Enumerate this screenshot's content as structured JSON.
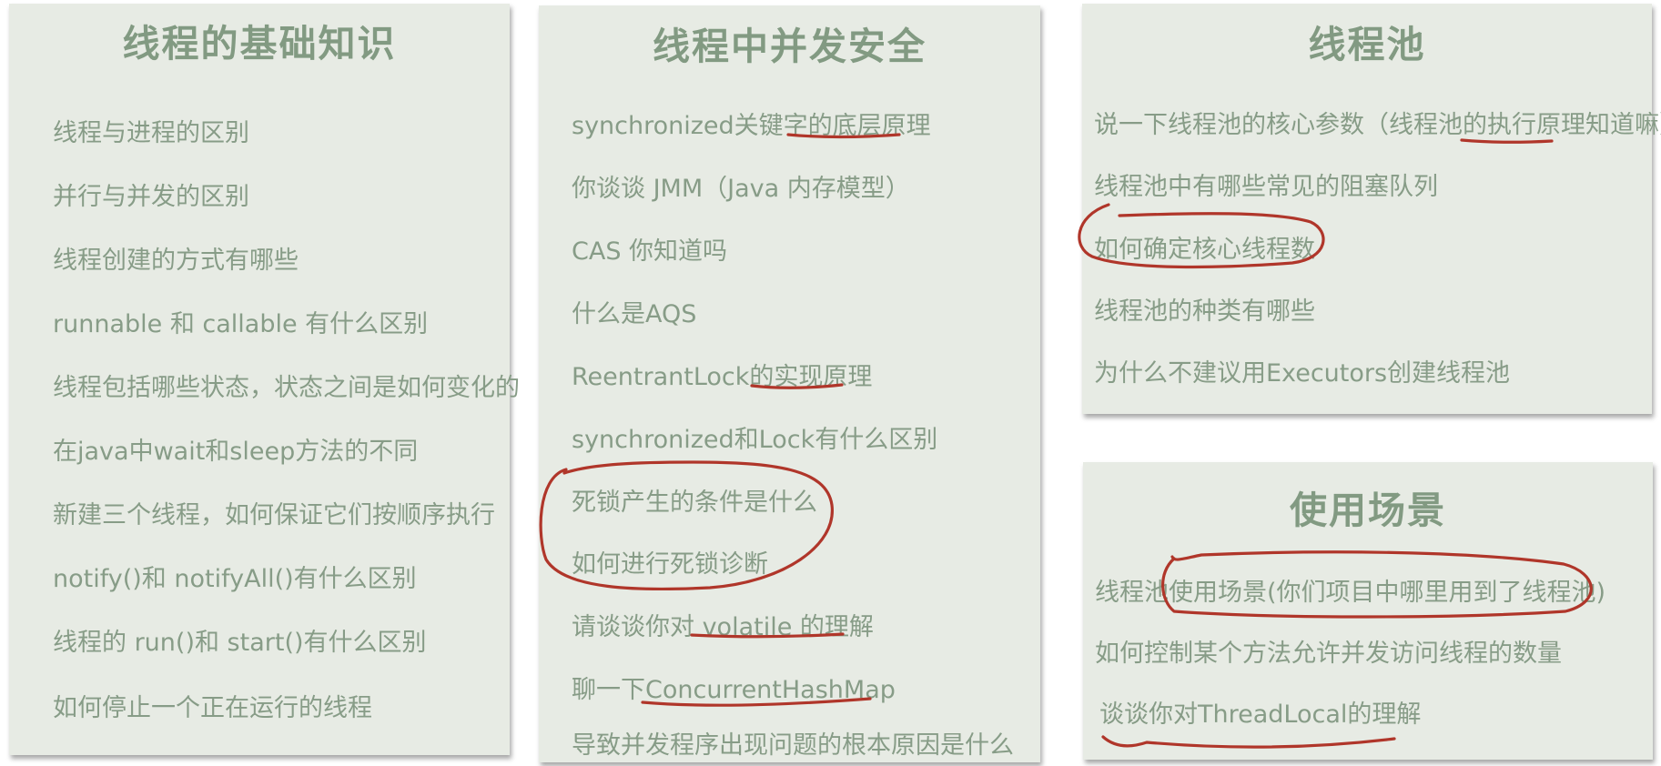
{
  "cards": {
    "basics": {
      "title": "线程的基础知识",
      "items": [
        "线程与进程的区别",
        "并行与并发的区别",
        "线程创建的方式有哪些",
        "runnable 和 callable 有什么区别",
        "线程包括哪些状态，状态之间是如何变化的",
        "在java中wait和sleep方法的不同",
        "新建三个线程，如何保证它们按顺序执行",
        "notify()和 notifyAll()有什么区别",
        "线程的 run()和 start()有什么区别",
        "如何停止一个正在运行的线程"
      ]
    },
    "safety": {
      "title": "线程中并发安全",
      "items": [
        "synchronized关键字的底层原理",
        "你谈谈 JMM（Java 内存模型）",
        "CAS 你知道吗",
        "什么是AQS",
        "ReentrantLock的实现原理",
        "synchronized和Lock有什么区别",
        "死锁产生的条件是什么",
        "如何进行死锁诊断",
        "请谈谈你对 volatile 的理解",
        "聊一下ConcurrentHashMap",
        "导致并发程序出现问题的根本原因是什么"
      ]
    },
    "pool": {
      "title": "线程池",
      "items": [
        "说一下线程池的核心参数（线程池的执行原理知道嘛）",
        "线程池中有哪些常见的阻塞队列",
        "如何确定核心线程数",
        "线程池的种类有哪些",
        "为什么不建议用Executors创建线程池"
      ]
    },
    "scenario": {
      "title": "使用场景",
      "items": [
        "线程池使用场景(你们项目中哪里用到了线程池)",
        "如何控制某个方法允许并发访问线程的数量",
        "谈谈你对ThreadLocal的理解"
      ]
    }
  },
  "colors": {
    "card_background": "#e7ebe4",
    "title_text": "#829a82",
    "item_text": "#879c87",
    "annotation_ink": "#b0362a"
  }
}
